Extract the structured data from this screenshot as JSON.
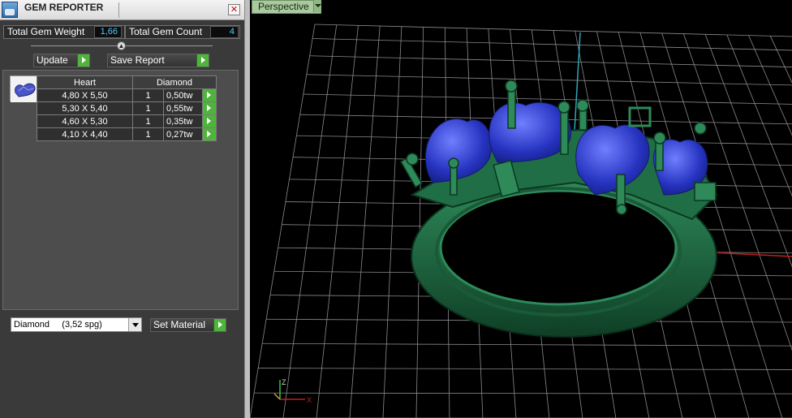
{
  "window": {
    "title": "GEM REPORTER",
    "close_label": "✕"
  },
  "summary": {
    "weight_label": "Total Gem Weight",
    "weight_value": "1,66",
    "count_label": "Total Gem Count",
    "count_value": "4"
  },
  "actions": {
    "update_label": "Update",
    "save_label": "Save Report"
  },
  "table": {
    "headers": {
      "shape": "Heart",
      "material": "Diamond"
    },
    "rows": [
      {
        "size": "4,80 X 5,50",
        "qty": "1",
        "weight": "0,50tw"
      },
      {
        "size": "5,30 X 5,40",
        "qty": "1",
        "weight": "0,55tw"
      },
      {
        "size": "4,60 X 5,30",
        "qty": "1",
        "weight": "0,35tw"
      },
      {
        "size": "4,10 X 4,40",
        "qty": "1",
        "weight": "0,27tw"
      }
    ]
  },
  "material": {
    "selected": "Diamond     (3,52 spg)",
    "set_label": "Set Material"
  },
  "viewport": {
    "view_mode": "Perspective",
    "axis_labels": {
      "x": "X",
      "z": "Z"
    }
  },
  "icons": [
    "app-icon",
    "collapse-icon",
    "heart-gem-icon",
    "play-arrow-icon",
    "dropdown-icon"
  ],
  "colors": {
    "accent_green": "#4fb43c",
    "value_blue": "#4fc8ff",
    "ring_green": "#1d6b43",
    "gem_blue": "#2a3dcc"
  }
}
